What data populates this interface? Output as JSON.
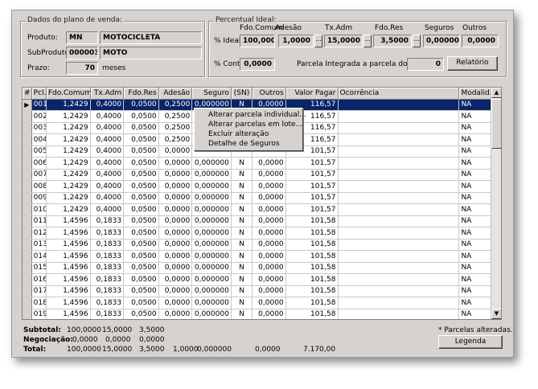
{
  "plano": {
    "title": "Dados do plano de venda:",
    "produto_label": "Produto:",
    "produto_code": "MN",
    "produto_name": "MOTOCICLETA",
    "subproduto_label": "SubProduto:",
    "subproduto_code": "000003",
    "subproduto_name": "MOTO",
    "prazo_label": "Prazo:",
    "prazo_value": "70",
    "prazo_unit": "meses"
  },
  "percentual": {
    "title": "Percentual Ideal:",
    "col_fdo_comum": "Fdo.Comum",
    "col_adesao": "Adesão",
    "col_tx_adm": "Tx.Adm",
    "col_fdo_res": "Fdo.Res",
    "col_seguros": "Seguros",
    "col_outros": "Outros",
    "ideal_label": "% Ideal:",
    "ideal_fdo_comum": "100,0000",
    "ideal_adesao": "1,0000",
    "ideal_tx_adm": "15,0000",
    "ideal_fdo_res": "3,5000",
    "ideal_seguros": "0,000000",
    "ideal_outros": "0,0000",
    "cont_label": "% Cont.:",
    "cont_value": "0,0000",
    "parcela_integrada_label": "Parcela Integrada a parcela do mês:",
    "parcela_integrada_value": "0",
    "relatorio_label": "Relatório",
    "dots": "..."
  },
  "grid": {
    "headers": [
      "#",
      "Pcl.",
      "Fdo.Comum",
      "Tx.Adm",
      "Fdo.Res",
      "Adesão",
      "Seguro",
      "(SN)",
      "Outros",
      "Valor Pagar",
      "Ocorrência",
      "Modalid."
    ],
    "rows": [
      [
        "*",
        "001",
        "1,2429",
        "0,4000",
        "0,0500",
        "0,2500",
        "0,000000",
        "N",
        "0,0000",
        "116,57",
        "",
        "NA"
      ],
      [
        "",
        "002",
        "1,2429",
        "0,4000",
        "0,0500",
        "0,2500",
        "",
        "",
        "",
        "116,57",
        "",
        "NA"
      ],
      [
        "",
        "003",
        "1,2429",
        "0,4000",
        "0,0500",
        "0,2500",
        "",
        "",
        "",
        "116,57",
        "",
        "NA"
      ],
      [
        "",
        "004",
        "1,2429",
        "0,4000",
        "0,0500",
        "0,2500",
        "",
        "",
        "",
        "116,57",
        "",
        "NA"
      ],
      [
        "",
        "005",
        "1,2429",
        "0,4000",
        "0,0500",
        "0,0000",
        "",
        "",
        "",
        "101,57",
        "",
        "NA"
      ],
      [
        "",
        "006",
        "1,2429",
        "0,4000",
        "0,0500",
        "0,0000",
        "0,000000",
        "N",
        "0,0000",
        "101,57",
        "",
        "NA"
      ],
      [
        "",
        "007",
        "1,2429",
        "0,4000",
        "0,0500",
        "0,0000",
        "0,000000",
        "N",
        "0,0000",
        "101,57",
        "",
        "NA"
      ],
      [
        "",
        "008",
        "1,2429",
        "0,4000",
        "0,0500",
        "0,0000",
        "0,000000",
        "N",
        "0,0000",
        "101,57",
        "",
        "NA"
      ],
      [
        "",
        "009",
        "1,2429",
        "0,4000",
        "0,0500",
        "0,0000",
        "0,000000",
        "N",
        "0,0000",
        "101,57",
        "",
        "NA"
      ],
      [
        "",
        "010",
        "1,2429",
        "0,4000",
        "0,0500",
        "0,0000",
        "0,000000",
        "N",
        "0,0000",
        "101,57",
        "",
        "NA"
      ],
      [
        "",
        "011",
        "1,4596",
        "0,1833",
        "0,0500",
        "0,0000",
        "0,000000",
        "N",
        "0,0000",
        "101,58",
        "",
        "NA"
      ],
      [
        "",
        "012",
        "1,4596",
        "0,1833",
        "0,0500",
        "0,0000",
        "0,000000",
        "N",
        "0,0000",
        "101,58",
        "",
        "NA"
      ],
      [
        "",
        "013",
        "1,4596",
        "0,1833",
        "0,0500",
        "0,0000",
        "0,000000",
        "N",
        "0,0000",
        "101,58",
        "",
        "NA"
      ],
      [
        "",
        "014",
        "1,4596",
        "0,1833",
        "0,0500",
        "0,0000",
        "0,000000",
        "N",
        "0,0000",
        "101,58",
        "",
        "NA"
      ],
      [
        "",
        "015",
        "1,4596",
        "0,1833",
        "0,0500",
        "0,0000",
        "0,000000",
        "N",
        "0,0000",
        "101,58",
        "",
        "NA"
      ],
      [
        "",
        "016",
        "1,4596",
        "0,1833",
        "0,0500",
        "0,0000",
        "0,000000",
        "N",
        "0,0000",
        "101,58",
        "",
        "NA"
      ],
      [
        "",
        "017",
        "1,4596",
        "0,1833",
        "0,0500",
        "0,0000",
        "0,000000",
        "N",
        "0,0000",
        "101,58",
        "",
        "NA"
      ],
      [
        "",
        "018",
        "1,4596",
        "0,1833",
        "0,0500",
        "0,0000",
        "0,000000",
        "N",
        "0,0000",
        "101,58",
        "",
        "NA"
      ],
      [
        "",
        "019",
        "1,4596",
        "0,1833",
        "0,0500",
        "0,0000",
        "0,000000",
        "N",
        "0,0000",
        "101,58",
        "",
        "NA"
      ]
    ]
  },
  "context_menu": {
    "items": [
      "Alterar parcela individual...",
      "Alterar parcelas em lote...",
      "Excluir alteração",
      "Detalhe de Seguros"
    ]
  },
  "footer": {
    "subtotal_label": "Subtotal:",
    "subtotal_fdo_comum": "100,0000",
    "subtotal_tx_adm": "15,0000",
    "subtotal_fdo_res": "3,5000",
    "negociacao_label": "Negociação:",
    "negociacao_fdo_comum": "0,0000",
    "negociacao_tx_adm": "0,0000",
    "negociacao_fdo_res": "0,0000",
    "total_label": "Total:",
    "total_fdo_comum": "100,0000",
    "total_tx_adm": "15,0000",
    "total_fdo_res": "3,5000",
    "total_adesao": "1,0000",
    "total_seguro": "0,000000",
    "total_outros": "0,0000",
    "total_valor": "7.170,00",
    "parcelas_alteradas_note": "* Parcelas alteradas.",
    "legenda_label": "Legenda"
  },
  "colors": {
    "window_bg": "#d6d3ce",
    "selection": "#0a246a"
  }
}
